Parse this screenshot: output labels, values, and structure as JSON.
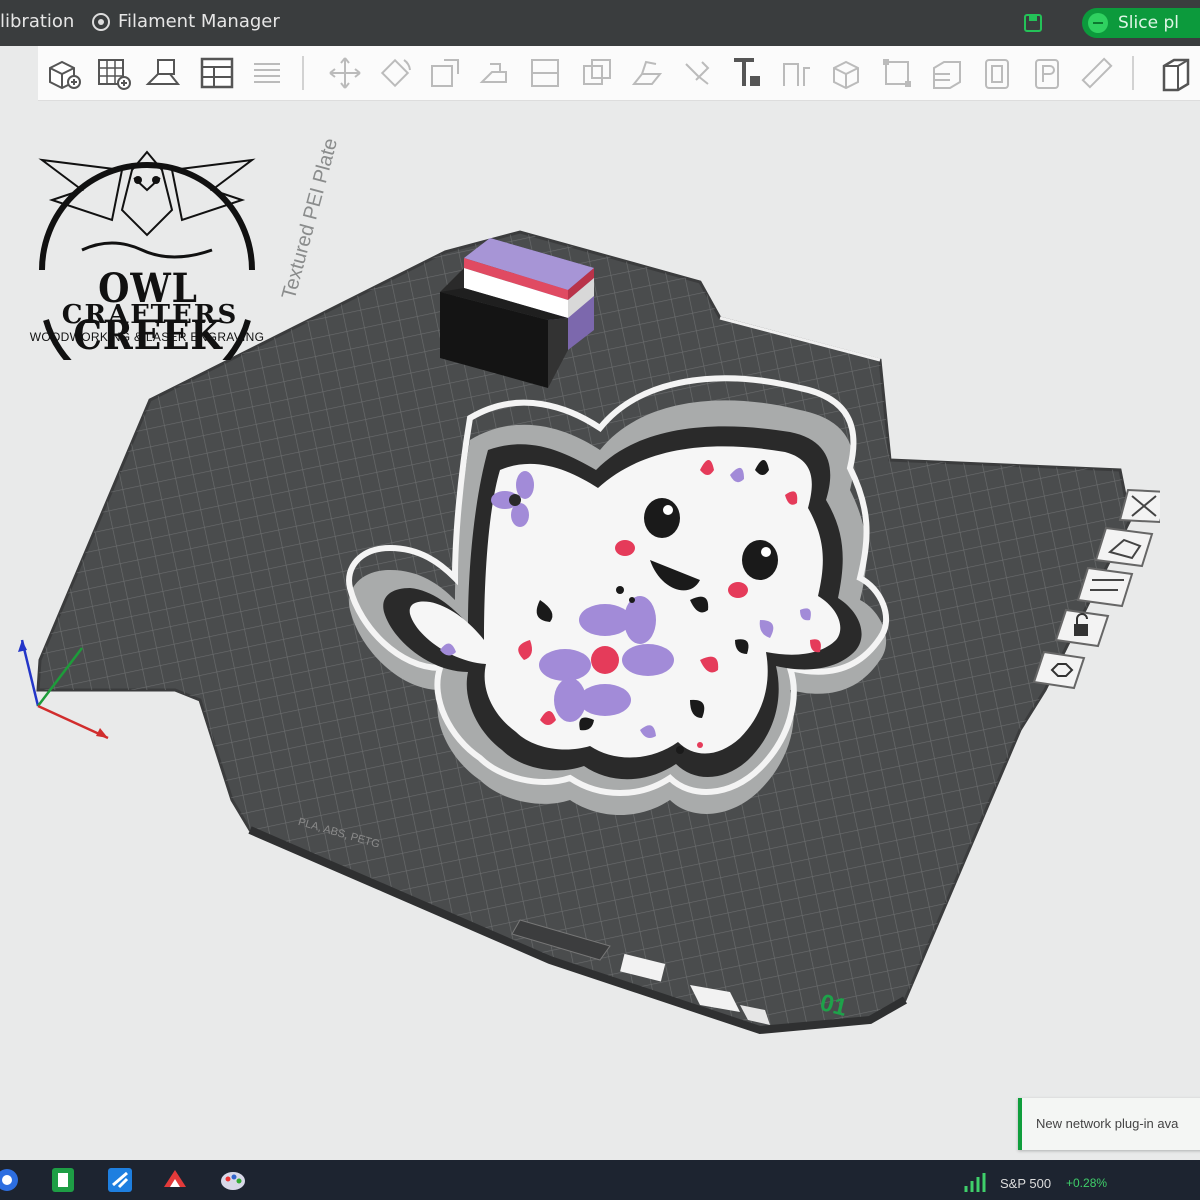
{
  "window": {
    "tabs": [
      "libration",
      "Filament Manager"
    ],
    "slice_label": "Slice pl"
  },
  "toolbar": {
    "tools": [
      "add-object-icon",
      "add-plate-icon",
      "arrange-icon",
      "layout-icon",
      "grid-list-icon",
      "move-icon",
      "rotate-icon",
      "scale-icon",
      "lay-on-face-icon",
      "cut-icon",
      "boolean-icon",
      "support-paint-icon",
      "seam-paint-icon",
      "text-icon",
      "measure-icon",
      "assembly-icon",
      "split-icon",
      "variable-layer-icon",
      "ruler-icon",
      "slice-plate-icon"
    ]
  },
  "logo": {
    "title": "OWL CREEK",
    "subtitle": "CRAFTERS",
    "tagline": "WOODWORKING & LASER ENGRAVING"
  },
  "plate": {
    "label": "Textured PEI Plate",
    "filament_types": "PLA, ABS, PETG",
    "plate_number": "01",
    "prime_tower_colors": [
      "#a795d6",
      "#e04a62",
      "#ffffff",
      "#1a1a1a"
    ],
    "surface_color": "#4a4c4d",
    "grid_color": "#6a6c6d"
  },
  "model": {
    "name": "ghost cookie cutter",
    "wall_color": "#a9abab",
    "petal_purple": "#a28bd8",
    "petal_pink": "#e53b5a"
  },
  "side_panel": {
    "buttons": [
      "close-view-icon",
      "orient-icon",
      "arrange-plate-icon",
      "lock-icon",
      "settings-icon"
    ]
  },
  "notification": {
    "text": "New network plug-in ava"
  },
  "taskbar": {
    "apps": [
      "windows-icon",
      "excel-icon",
      "mail-icon",
      "bambu-icon",
      "paint-icon"
    ],
    "market_name": "S&P 500",
    "market_change": "+0.28%"
  }
}
